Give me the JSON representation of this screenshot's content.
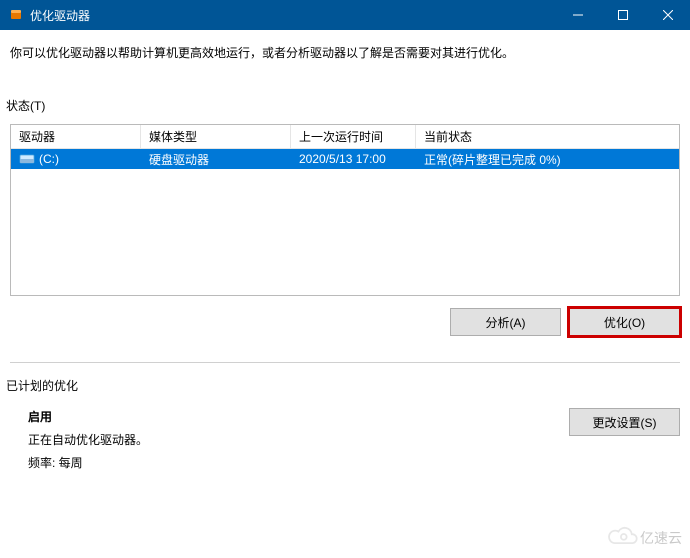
{
  "window": {
    "title": "优化驱动器"
  },
  "description": "你可以优化驱动器以帮助计算机更高效地运行，或者分析驱动器以了解是否需要对其进行优化。",
  "status_label": "状态(T)",
  "columns": {
    "drive": "驱动器",
    "media": "媒体类型",
    "last_run": "上一次运行时间",
    "current": "当前状态"
  },
  "rows": [
    {
      "drive": "(C:)",
      "media": "硬盘驱动器",
      "last_run": "2020/5/13 17:00",
      "current": "正常(碎片整理已完成 0%)"
    }
  ],
  "buttons": {
    "analyze": "分析(A)",
    "optimize": "优化(O)",
    "change_settings": "更改设置(S)"
  },
  "schedule": {
    "section_label": "已计划的优化",
    "title": "启用",
    "desc": "正在自动优化驱动器。",
    "freq_label": "频率: 每周"
  },
  "watermark": {
    "text": "亿速云"
  }
}
